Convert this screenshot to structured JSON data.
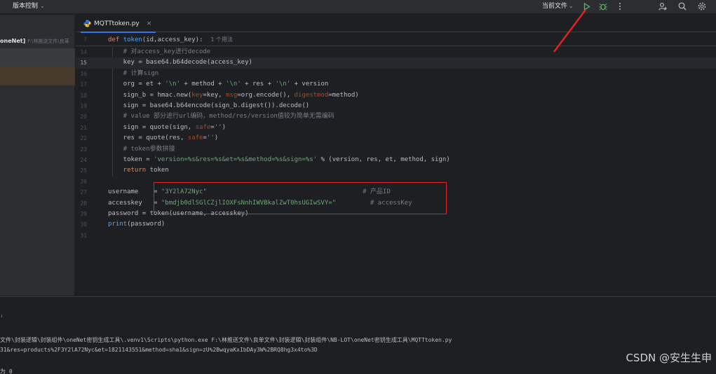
{
  "topbar": {
    "vcs_label": "版本控制",
    "run_config": "当前文件",
    "icons": [
      "run-icon",
      "debug-icon",
      "more-icon",
      "add-user-icon",
      "search-icon",
      "settings-icon"
    ]
  },
  "project": {
    "name": "oneNet]",
    "path": "F:\\林推送文件\\良革"
  },
  "tab": {
    "filename": "MQTTtoken.py"
  },
  "sticky": {
    "line_no": "7",
    "def_kw": "def",
    "func": "token",
    "params": "(id,access_key):",
    "usage_hint": "1 个用法"
  },
  "editor": {
    "lines": [
      {
        "no": "14",
        "current": false,
        "segments": [
          [
            "cm",
            "    # 对access_key进行decode"
          ]
        ]
      },
      {
        "no": "15",
        "current": true,
        "segments": [
          [
            "pl",
            "    key = base64.b64decode(access_key)"
          ]
        ]
      },
      {
        "no": "16",
        "current": false,
        "segments": [
          [
            "cm",
            "    # 计算sign"
          ]
        ]
      },
      {
        "no": "17",
        "current": false,
        "segments": [
          [
            "pl",
            "    org = et + "
          ],
          [
            "str",
            "'\\n'"
          ],
          [
            "pl",
            " + method + "
          ],
          [
            "str",
            "'\\n'"
          ],
          [
            "pl",
            " + res + "
          ],
          [
            "str",
            "'\\n'"
          ],
          [
            "pl",
            " + version"
          ]
        ]
      },
      {
        "no": "18",
        "current": false,
        "segments": [
          [
            "pl",
            "    sign_b = hmac.new("
          ],
          [
            "param",
            "key"
          ],
          [
            "pl",
            "=key, "
          ],
          [
            "param",
            "msg"
          ],
          [
            "pl",
            "=org.encode(), "
          ],
          [
            "param",
            "digestmod"
          ],
          [
            "pl",
            "=method)"
          ]
        ]
      },
      {
        "no": "19",
        "current": false,
        "segments": [
          [
            "pl",
            "    sign = base64.b64encode(sign_b.digest()).decode()"
          ]
        ]
      },
      {
        "no": "20",
        "current": false,
        "segments": [
          [
            "cm",
            "    # value 部分进行url编码，method/res/version值较为简单无需编码"
          ]
        ]
      },
      {
        "no": "21",
        "current": false,
        "segments": [
          [
            "pl",
            "    sign = quote(sign, "
          ],
          [
            "param",
            "safe"
          ],
          [
            "pl",
            "="
          ],
          [
            "str",
            "''"
          ],
          [
            "pl",
            ")"
          ]
        ]
      },
      {
        "no": "22",
        "current": false,
        "segments": [
          [
            "pl",
            "    res = quote(res, "
          ],
          [
            "param",
            "safe"
          ],
          [
            "pl",
            "="
          ],
          [
            "str",
            "''"
          ],
          [
            "pl",
            ")"
          ]
        ]
      },
      {
        "no": "23",
        "current": false,
        "segments": [
          [
            "cm",
            "    # token参数拼接"
          ]
        ]
      },
      {
        "no": "24",
        "current": false,
        "segments": [
          [
            "pl",
            "    token = "
          ],
          [
            "str",
            "'version=%s&res=%s&et=%s&method=%s&sign=%s'"
          ],
          [
            "pl",
            " % (version, res, et, method, sign)"
          ]
        ]
      },
      {
        "no": "25",
        "current": false,
        "segments": [
          [
            "kw",
            "    return"
          ],
          [
            "pl",
            " token"
          ]
        ]
      },
      {
        "no": "26",
        "current": false,
        "segments": []
      },
      {
        "no": "27",
        "current": false,
        "segments": [
          [
            "pl",
            "username    = "
          ],
          [
            "str",
            "\"3Y2lA72Nyc\""
          ],
          [
            "pl",
            "                                         "
          ],
          [
            "cm",
            "# 产品ID"
          ]
        ]
      },
      {
        "no": "28",
        "current": false,
        "segments": [
          [
            "pl",
            "accesskey   = "
          ],
          [
            "str",
            "\"bmdjb0dlSGlCZjlIOXFsNnhIWVBkalZwT0hsUGIwSVY=\""
          ],
          [
            "pl",
            "         "
          ],
          [
            "cm",
            "# accessKey"
          ]
        ]
      },
      {
        "no": "29",
        "current": false,
        "segments": [
          [
            "pl",
            "password = token(username, accesskey)"
          ]
        ]
      },
      {
        "no": "30",
        "current": false,
        "segments": [
          [
            "fn",
            "print"
          ],
          [
            "pl",
            "(password)"
          ]
        ]
      },
      {
        "no": "31",
        "current": false,
        "segments": []
      }
    ]
  },
  "run": {
    "prompt_mark": "↓",
    "command": "文件\\封装逻辑\\封装组件\\oneNet密钥生成工具\\.venv1\\Scripts\\python.exe F:\\林推送文件\\良单文件\\封装逻辑\\封装组件\\NB-LOT\\oneNet密钥生成工具\\MQTTtoken.py",
    "output": "31&res=products%2F3Y2lA72Nyc&et=1821143551&method=sha1&sign=zU%2BwqyaKxIbDAy3W%2BRQ8hg3x4to%3D",
    "exit": "为 0"
  },
  "watermark": "CSDN @安生生申",
  "colors": {
    "accent": "#3574f0",
    "annotation_red": "#e02424",
    "run_green": "#5fb865"
  }
}
